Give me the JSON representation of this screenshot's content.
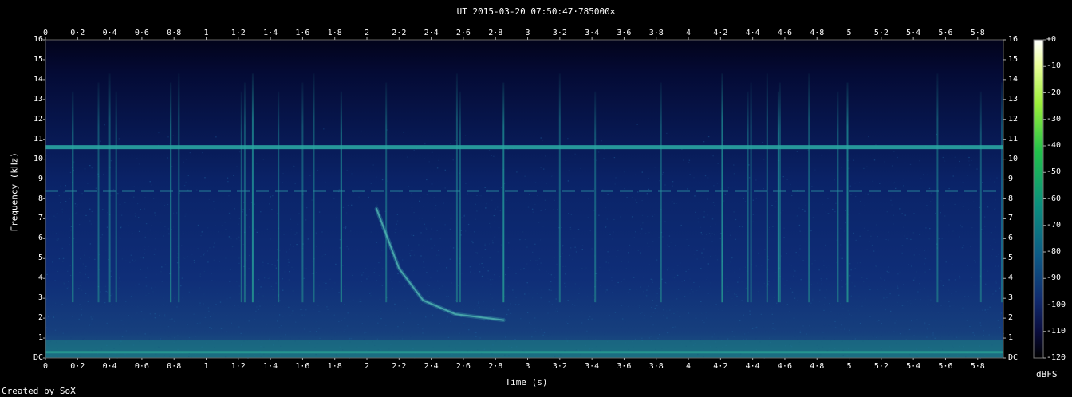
{
  "title": "UT 2015-03-20 07:50:47·785000×",
  "credit": "Created by SoX",
  "chart_data": {
    "type": "heatmap",
    "title": "UT 2015-03-20 07:50:47·785000×",
    "xlabel": "Time (s)",
    "ylabel": "Frequency (kHz)",
    "xlim": [
      0,
      5.96
    ],
    "ylim": [
      0,
      16
    ],
    "x_ticks": [
      "0",
      "0·2",
      "0·4",
      "0·6",
      "0·8",
      "1",
      "1·2",
      "1·4",
      "1·6",
      "1·8",
      "2",
      "2·2",
      "2·4",
      "2·6",
      "2·8",
      "3",
      "3·2",
      "3·4",
      "3·6",
      "3·8",
      "4",
      "4·2",
      "4·4",
      "4·6",
      "4·8",
      "5",
      "5·2",
      "5·4",
      "5·6",
      "5·8"
    ],
    "y_ticks": [
      "DC",
      "1",
      "2",
      "3",
      "4",
      "5",
      "6",
      "7",
      "8",
      "9",
      "10",
      "11",
      "12",
      "13",
      "14",
      "15",
      "16"
    ],
    "colorbar": {
      "label": "dBFS",
      "ticks": [
        "+0",
        "-10",
        "-20",
        "-30",
        "-40",
        "-50",
        "-60",
        "-70",
        "-80",
        "-90",
        "-100",
        "-110",
        "-120"
      ],
      "range": [
        -120,
        0
      ]
    },
    "features": {
      "constant_tone_khz": 10.6,
      "dashed_tone_khz": 8.4,
      "whistler": [
        [
          2.06,
          7.5
        ],
        [
          2.2,
          4.5
        ],
        [
          2.35,
          2.9
        ],
        [
          2.55,
          2.2
        ],
        [
          2.85,
          1.9
        ]
      ],
      "impulses_s": [
        0.17,
        0.33,
        0.4,
        0.44,
        0.78,
        0.83,
        1.22,
        1.24,
        1.29,
        1.45,
        1.6,
        1.67,
        1.84,
        2.12,
        2.56,
        2.58,
        2.85,
        3.2,
        3.42,
        3.83,
        4.21,
        4.37,
        4.39,
        4.49,
        4.56,
        4.57,
        4.75,
        4.93,
        4.99,
        5.55,
        5.82,
        5.95
      ]
    }
  }
}
